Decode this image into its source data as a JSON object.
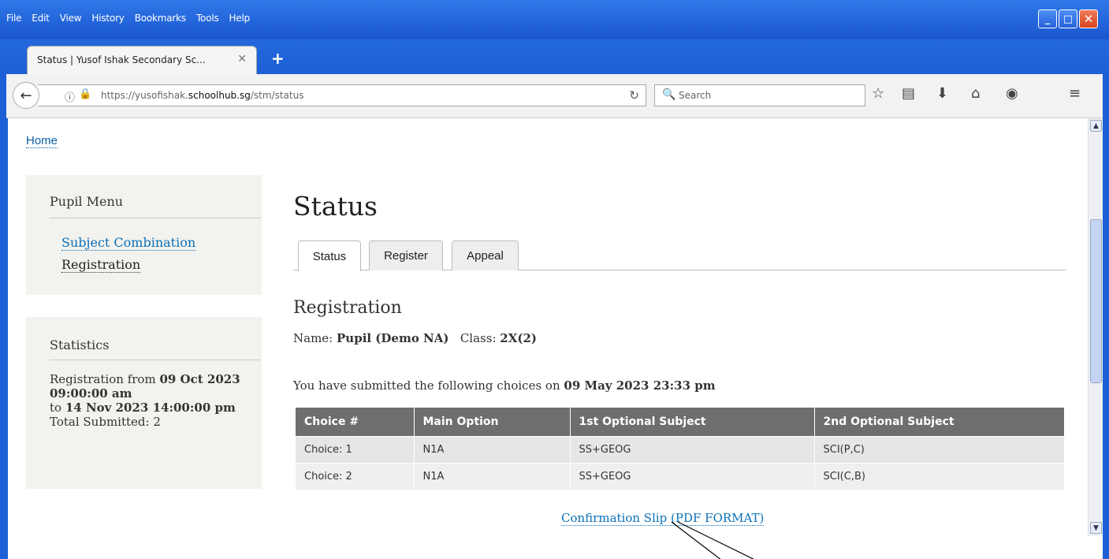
{
  "browser": {
    "menu": [
      "File",
      "Edit",
      "View",
      "History",
      "Bookmarks",
      "Tools",
      "Help"
    ],
    "tab_title": "Status | Yusof Ishak Secondary Sc...",
    "url_prefix": "https://yusofishak.",
    "url_domain": "schoolhub.sg",
    "url_path": "/stm/status",
    "search_placeholder": "Search"
  },
  "page": {
    "home_link": "Home",
    "pupil_menu": {
      "title": "Pupil Menu",
      "items": [
        "Subject Combination",
        "Registration"
      ]
    },
    "statistics": {
      "title": "Statistics",
      "registration_from_label": "Registration from",
      "registration_from": "09 Oct 2023 09:00:00 am",
      "to_label": "to",
      "registration_to": "14 Nov 2023 14:00:00 pm",
      "total_label": "Total Submitted:",
      "total": "2"
    },
    "title": "Status",
    "tabs": [
      "Status",
      "Register",
      "Appeal"
    ],
    "section": "Registration",
    "name_label": "Name:",
    "name": "Pupil (Demo NA)",
    "class_label": "Class:",
    "class": "2X(2)",
    "submitted_prefix": "You have submitted the following choices on",
    "submitted_date": "09 May 2023 23:33 pm",
    "table": {
      "headers": [
        "Choice #",
        "Main Option",
        "1st Optional Subject",
        "2nd Optional Subject"
      ],
      "rows": [
        [
          "Choice: 1",
          "N1A",
          "SS+GEOG",
          "SCI(P,C)"
        ],
        [
          "Choice: 2",
          "N1A",
          "SS+GEOG",
          "SCI(C,B)"
        ]
      ]
    },
    "slip_link": "Confirmation Slip (PDF FORMAT)"
  }
}
